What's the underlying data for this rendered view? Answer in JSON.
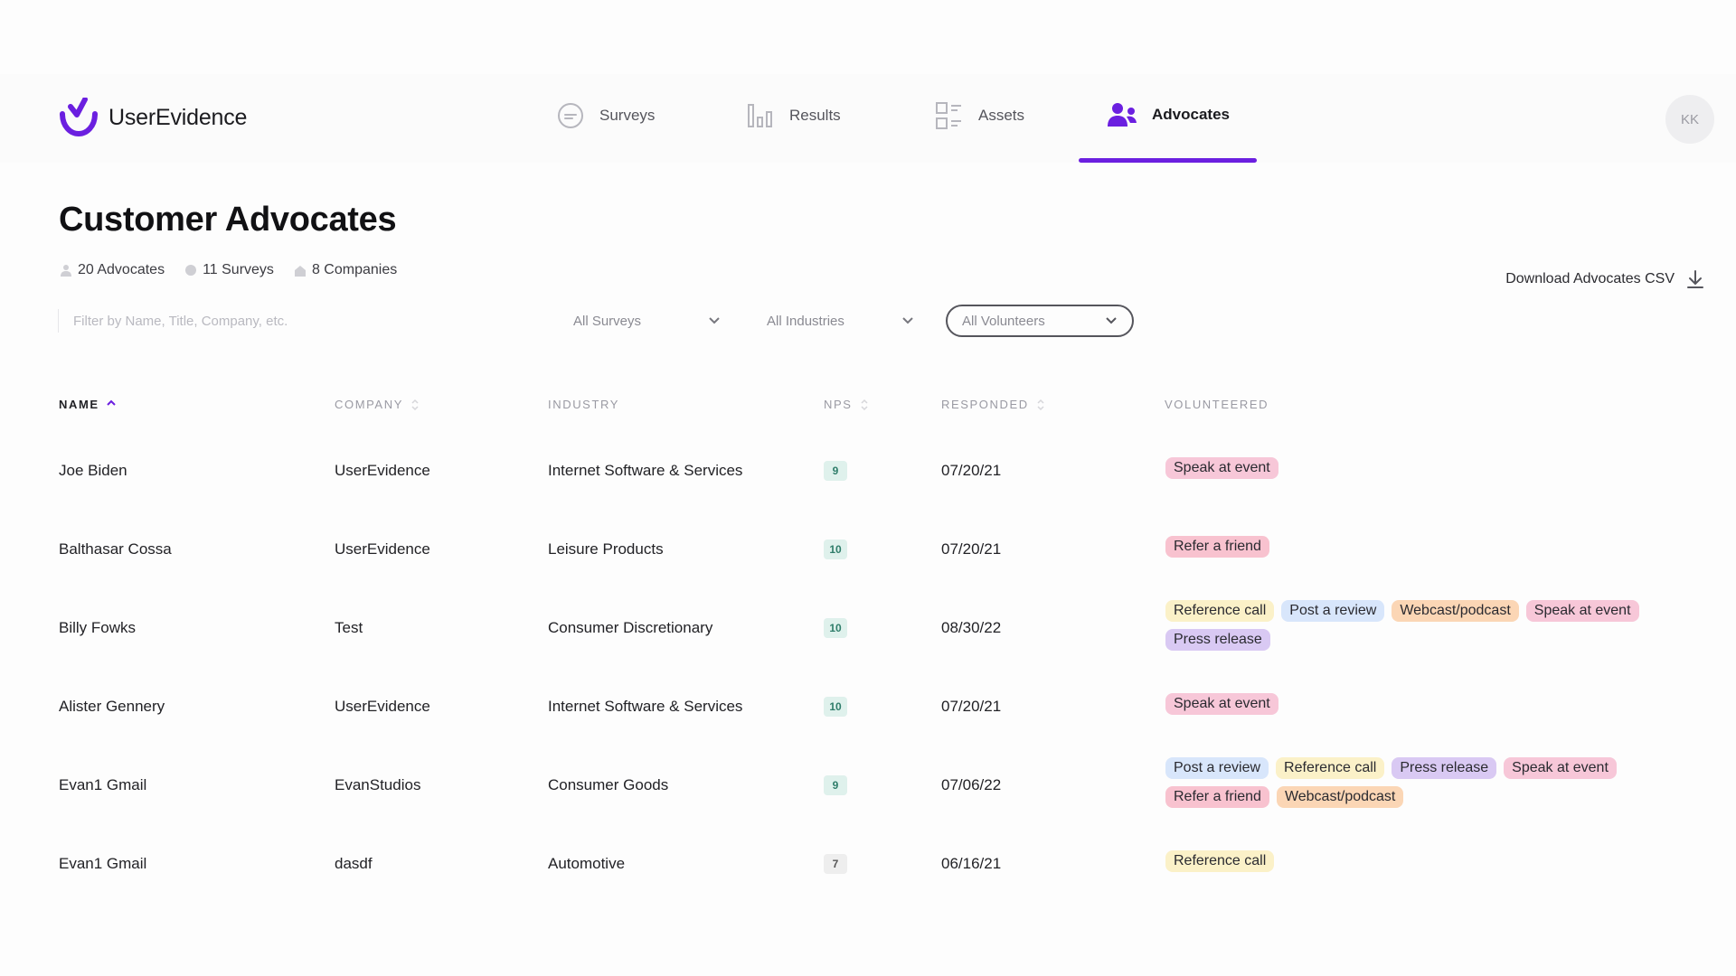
{
  "app": {
    "name": "UserEvidence",
    "avatar_initials": "KK"
  },
  "nav": {
    "items": [
      {
        "label": "Surveys",
        "icon": "chat-bubble-icon"
      },
      {
        "label": "Results",
        "icon": "bar-chart-icon"
      },
      {
        "label": "Assets",
        "icon": "grid-list-icon"
      },
      {
        "label": "Advocates",
        "icon": "users-icon",
        "active": true
      }
    ],
    "accent_color": "#6b1fe0"
  },
  "page": {
    "title": "Customer Advocates",
    "stats": {
      "advocates": "20 Advocates",
      "surveys": "11 Surveys",
      "companies": "8 Companies"
    },
    "download_label": "Download Advocates CSV"
  },
  "filters": {
    "search_placeholder": "Filter by Name, Title, Company, etc.",
    "surveys": "All Surveys",
    "industries": "All Industries",
    "volunteers": "All Volunteers"
  },
  "table": {
    "headers": {
      "name": "NAME",
      "company": "COMPANY",
      "industry": "INDUSTRY",
      "nps": "NPS",
      "responded": "RESPONDED",
      "volunteered": "VOLUNTEERED"
    },
    "rows": [
      {
        "name": "Joe Biden",
        "company": "UserEvidence",
        "industry": "Internet Software & Services",
        "nps": "9",
        "responded": "07/20/21",
        "volunteered": [
          {
            "label": "Speak at event",
            "kind": "speak"
          }
        ]
      },
      {
        "name": "Balthasar Cossa",
        "company": "UserEvidence",
        "industry": "Leisure Products",
        "nps": "10",
        "responded": "07/20/21",
        "volunteered": [
          {
            "label": "Refer a friend",
            "kind": "refer"
          }
        ]
      },
      {
        "name": "Billy Fowks",
        "company": "Test",
        "industry": "Consumer Discretionary",
        "nps": "10",
        "responded": "08/30/22",
        "volunteered": [
          {
            "label": "Reference call",
            "kind": "refcall"
          },
          {
            "label": "Post a review",
            "kind": "review"
          },
          {
            "label": "Webcast/podcast",
            "kind": "webcast"
          },
          {
            "label": "Speak at event",
            "kind": "speak"
          },
          {
            "label": "Press release",
            "kind": "press"
          }
        ]
      },
      {
        "name": "Alister Gennery",
        "company": "UserEvidence",
        "industry": "Internet Software & Services",
        "nps": "10",
        "responded": "07/20/21",
        "volunteered": [
          {
            "label": "Speak at event",
            "kind": "speak"
          }
        ]
      },
      {
        "name": "Evan1 Gmail",
        "company": "EvanStudios",
        "industry": "Consumer Goods",
        "nps": "9",
        "responded": "07/06/22",
        "volunteered": [
          {
            "label": "Post a review",
            "kind": "review"
          },
          {
            "label": "Reference call",
            "kind": "refcall"
          },
          {
            "label": "Press release",
            "kind": "press"
          },
          {
            "label": "Speak at event",
            "kind": "speak"
          },
          {
            "label": "Refer a friend",
            "kind": "refer"
          },
          {
            "label": "Webcast/podcast",
            "kind": "webcast"
          }
        ]
      },
      {
        "name": "Evan1 Gmail",
        "company": "dasdf",
        "industry": "Automotive",
        "nps": "7",
        "responded": "06/16/21",
        "volunteered": [
          {
            "label": "Reference call",
            "kind": "refcall"
          }
        ]
      }
    ]
  },
  "colors": {
    "nps_promoter_bg": "#dff1ec",
    "nps_promoter_fg": "#2f7d6a",
    "nps_passive_bg": "#eeeeee",
    "nps_passive_fg": "#555555"
  }
}
